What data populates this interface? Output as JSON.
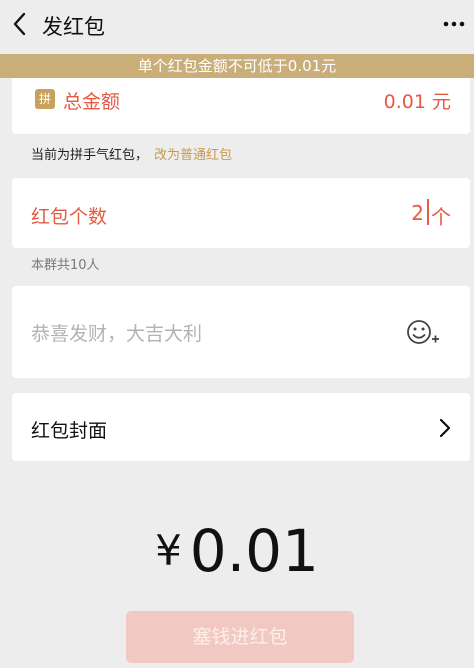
{
  "header": {
    "title": "发红包"
  },
  "warning": "单个红包金额不可低于0.01元",
  "amount": {
    "badge": "拼",
    "label": "总金额",
    "value": "0.01 元"
  },
  "hint": {
    "text": "当前为拼手气红包，",
    "link": "改为普通红包"
  },
  "count": {
    "label": "红包个数",
    "value": "2",
    "unit": "个"
  },
  "group_size": "本群共10人",
  "greeting": {
    "placeholder": "恭喜发财，大吉大利"
  },
  "cover": {
    "label": "红包封面"
  },
  "total": {
    "currency": "¥",
    "value": "0.01"
  },
  "submit": {
    "label": "塞钱进红包"
  },
  "colors": {
    "accent_red": "#e55a42",
    "gold": "#c9ae7a",
    "button_disabled": "#f2c9c2"
  },
  "icons": {
    "back": "chevron-left-icon",
    "more": "more-dots-icon",
    "emoji": "emoji-add-icon",
    "cover_arrow": "chevron-right-icon"
  }
}
